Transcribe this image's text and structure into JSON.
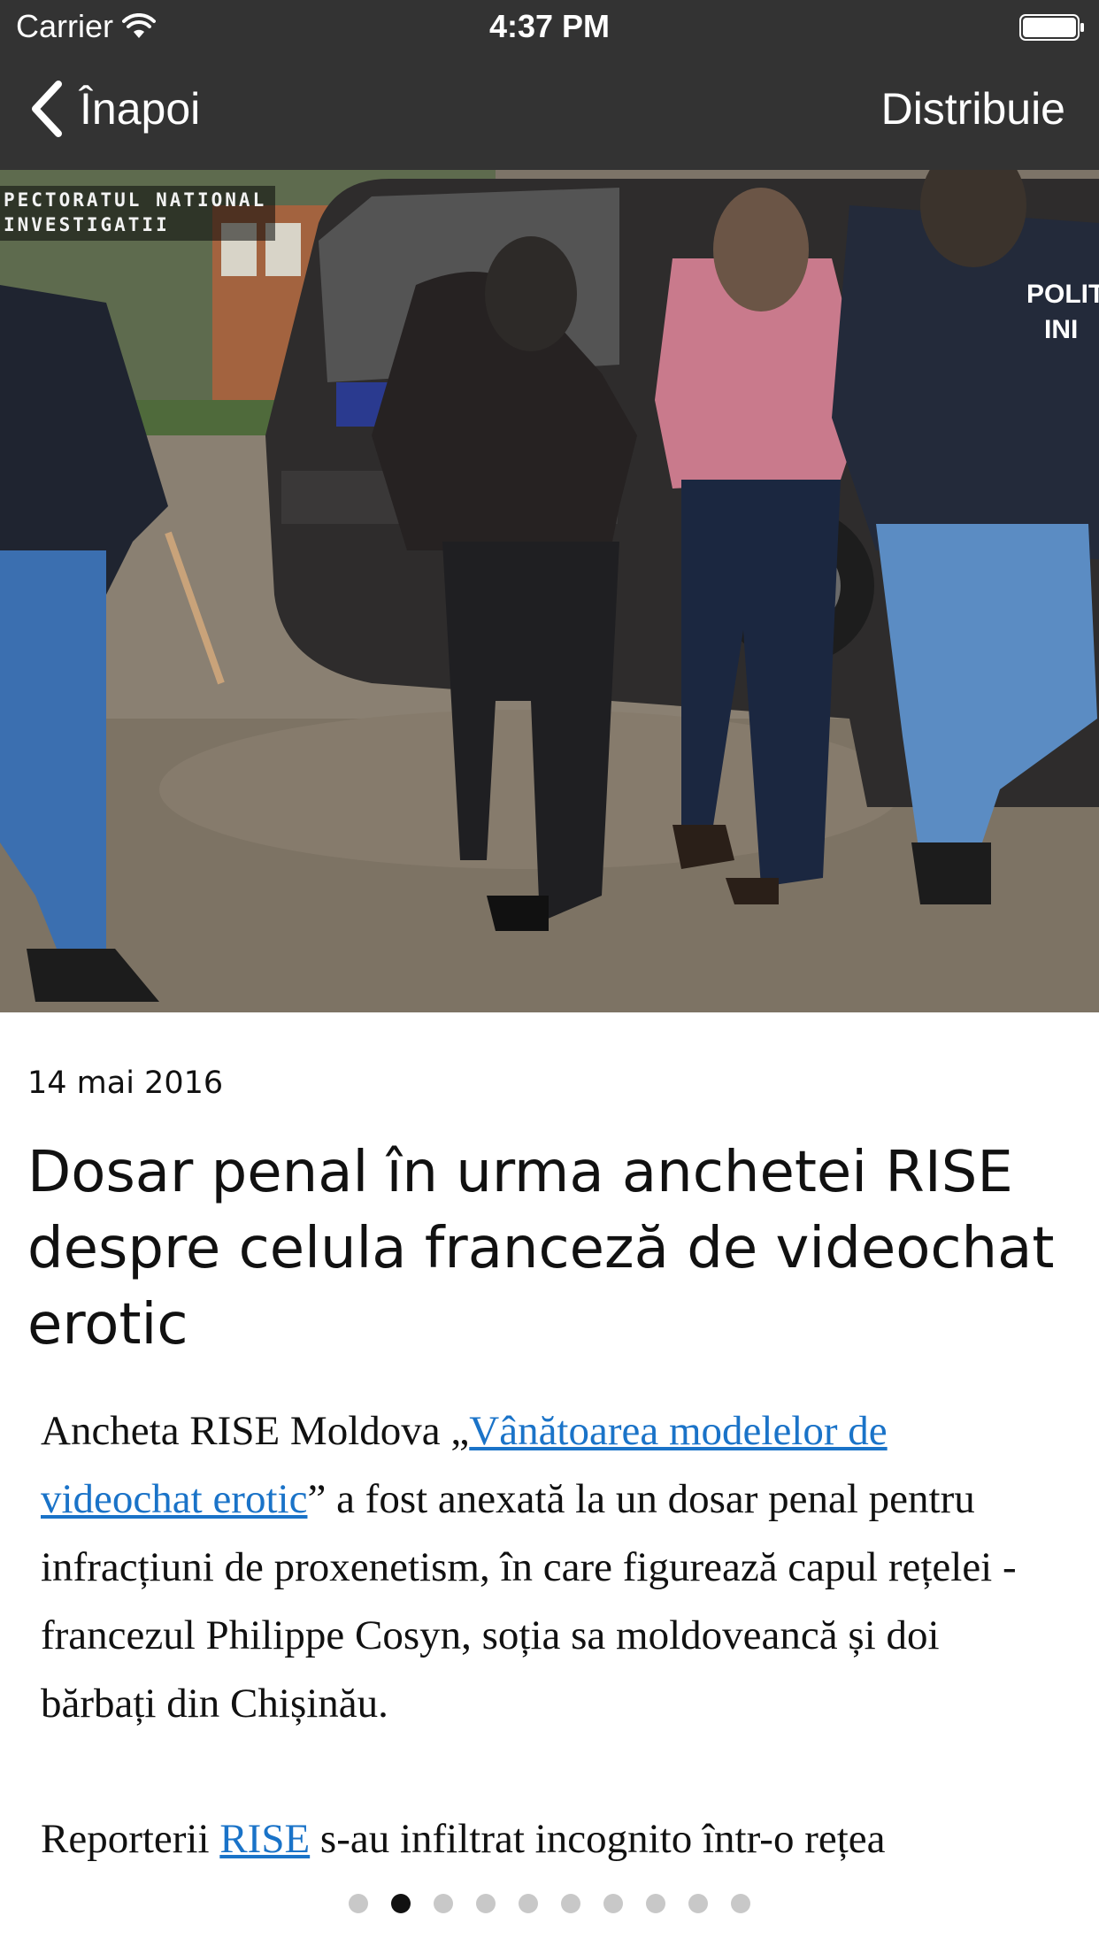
{
  "status_bar": {
    "carrier": "Carrier",
    "time": "4:37 PM",
    "icons": [
      "wifi-icon",
      "battery-icon"
    ]
  },
  "nav": {
    "back_label": "Înapoi",
    "back_icon": "chevron-left-icon",
    "share_label": "Distribuie",
    "bar_color": "#333333"
  },
  "hero": {
    "watermark_line1": "PECTORATUL NATIONAL",
    "watermark_line2": "INVESTIGATII",
    "vest_text_line1": "POLITI",
    "vest_text_line2": "INI"
  },
  "article": {
    "date": "14 mai 2016",
    "title": "Dosar penal în urma anchetei RISE despre celula franceză de videochat erotic",
    "p1_before": "Ancheta RISE Moldova „",
    "p1_link": "Vânătoarea modelelor de videochat erotic",
    "p1_after": "” a fost anexată la un dosar penal pentru infracțiuni de proxenetism, în care figurează capul rețelei - francezul Philippe Cosyn, soția sa moldoveancă și doi bărbați din Chișinău.",
    "p2_before": "Reporterii ",
    "p2_link": "RISE",
    "p2_after": " s-au infiltrat incognito într-o rețea",
    "link_color": "#1a73c8"
  },
  "pagination": {
    "total": 10,
    "active_index": 1
  }
}
